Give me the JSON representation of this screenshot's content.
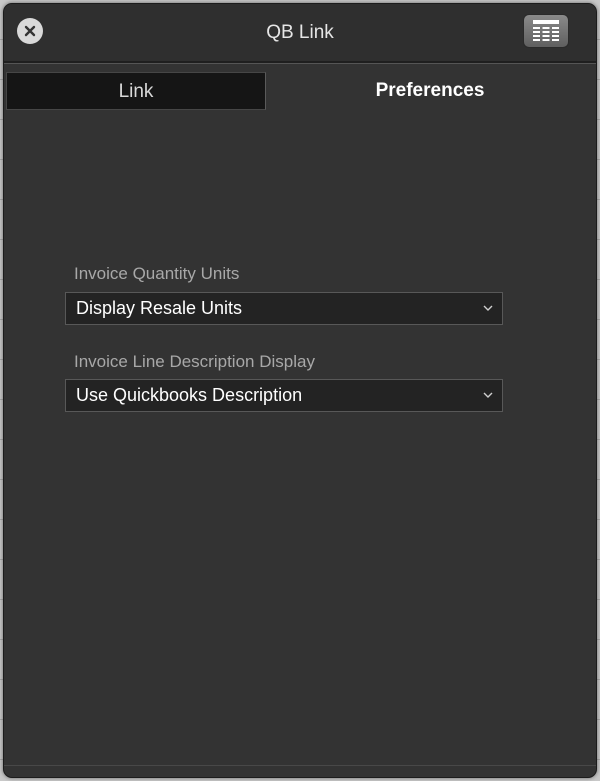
{
  "window": {
    "title": "QB Link"
  },
  "tabs": [
    {
      "label": "Link",
      "active": false
    },
    {
      "label": "Preferences",
      "active": true
    }
  ],
  "preferences": {
    "quantity_units": {
      "label": "Invoice Quantity Units",
      "value": "Display Resale Units"
    },
    "line_description": {
      "label": "Invoice Line Description Display",
      "value": "Use Quickbooks Description"
    }
  },
  "icons": {
    "close": "close-icon",
    "menu": "table-menu-icon",
    "dropdown": "chevron-down-icon"
  },
  "colors": {
    "window_bg": "#333333",
    "titlebar_bg": "#2f2f2f",
    "inactive_tab_bg": "#151515",
    "select_bg": "#232323",
    "label_text": "#a8a8a8"
  }
}
